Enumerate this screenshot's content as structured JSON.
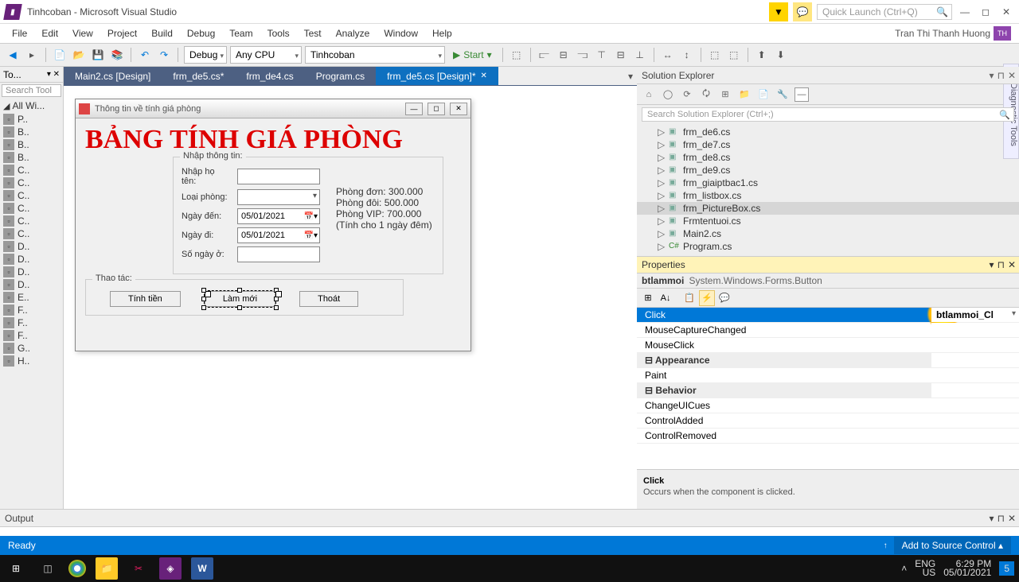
{
  "title": "Tinhcoban - Microsoft Visual Studio",
  "quick_launch": "Quick Launch (Ctrl+Q)",
  "user_name": "Tran Thi Thanh Huong",
  "user_badge": "TH",
  "menu": [
    "File",
    "Edit",
    "View",
    "Project",
    "Build",
    "Debug",
    "Team",
    "Tools",
    "Test",
    "Analyze",
    "Window",
    "Help"
  ],
  "toolbar": {
    "config": "Debug",
    "platform": "Any CPU",
    "startup": "Tinhcoban",
    "start": "Start"
  },
  "toolbox": {
    "title": "To...",
    "search": "Search Tool",
    "group": "All Wi...",
    "items": [
      "P..",
      "B..",
      "B..",
      "B..",
      "C..",
      "C..",
      "C..",
      "C..",
      "C..",
      "C..",
      "D..",
      "D..",
      "D..",
      "D..",
      "E..",
      "F..",
      "F..",
      "F..",
      "G..",
      "H.."
    ]
  },
  "tabs": [
    {
      "label": "Main2.cs [Design]",
      "active": false
    },
    {
      "label": "frm_de5.cs*",
      "active": false
    },
    {
      "label": "frm_de4.cs",
      "active": false
    },
    {
      "label": "Program.cs",
      "active": false
    },
    {
      "label": "frm_de5.cs [Design]*",
      "active": true
    }
  ],
  "form": {
    "title": "Thông tin về tính giá phòng",
    "heading": "BẢNG TÍNH GIÁ PHÒNG",
    "grp_input": "Nhập thông tin:",
    "lbl_name": "Nhập họ tên:",
    "lbl_room": "Loại phòng:",
    "lbl_in": "Ngày đến:",
    "lbl_out": "Ngày đi:",
    "lbl_days": "Số ngày ở:",
    "date_in": "05/01/2021",
    "date_out": "05/01/2021",
    "info": [
      "Phòng đơn: 300.000",
      "Phòng đôi: 500.000",
      "Phòng VIP: 700.000",
      "(Tính cho 1 ngày đêm)"
    ],
    "grp_ops": "Thao tác:",
    "btn_calc": "Tính tiền",
    "btn_reset": "Làm mới",
    "btn_exit": "Thoát"
  },
  "solution": {
    "title": "Solution Explorer",
    "search": "Search Solution Explorer (Ctrl+;)",
    "items": [
      {
        "name": "frm_de6.cs",
        "t": "form"
      },
      {
        "name": "frm_de7.cs",
        "t": "form"
      },
      {
        "name": "frm_de8.cs",
        "t": "form"
      },
      {
        "name": "frm_de9.cs",
        "t": "form"
      },
      {
        "name": "frm_giaiptbac1.cs",
        "t": "form"
      },
      {
        "name": "frm_listbox.cs",
        "t": "form"
      },
      {
        "name": "frm_PictureBox.cs",
        "t": "form",
        "hl": true
      },
      {
        "name": "Frmtentuoi.cs",
        "t": "form"
      },
      {
        "name": "Main2.cs",
        "t": "form"
      },
      {
        "name": "Program.cs",
        "t": "cs"
      }
    ]
  },
  "properties": {
    "title": "Properties",
    "object_name": "btlammoi",
    "object_type": "System.Windows.Forms.Button",
    "rows": [
      {
        "name": "Click",
        "val": "btlammoi_Cl",
        "sel": true
      },
      {
        "name": "MouseCaptureChanged",
        "val": ""
      },
      {
        "name": "MouseClick",
        "val": ""
      },
      {
        "name": "Appearance",
        "cat": true
      },
      {
        "name": "Paint",
        "val": ""
      },
      {
        "name": "Behavior",
        "cat": true
      },
      {
        "name": "ChangeUICues",
        "val": ""
      },
      {
        "name": "ControlAdded",
        "val": ""
      },
      {
        "name": "ControlRemoved",
        "val": ""
      }
    ],
    "desc_title": "Click",
    "desc_text": "Occurs when the component is clicked."
  },
  "output": {
    "title": "Output"
  },
  "status": {
    "ready": "Ready",
    "src": "Add to Source Control"
  },
  "diag": "Diagnostic Tools",
  "tray": {
    "lang1": "ENG",
    "lang2": "US",
    "time": "6:29 PM",
    "date": "05/01/2021",
    "notif": "5"
  }
}
